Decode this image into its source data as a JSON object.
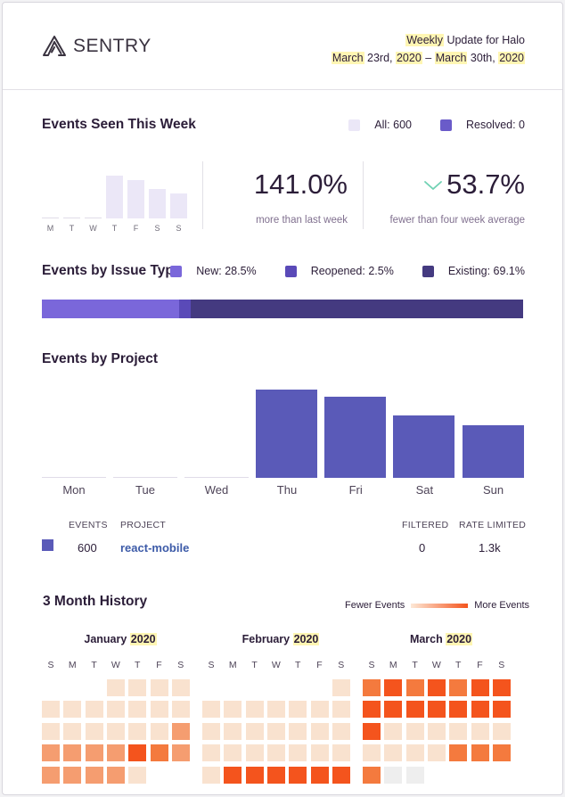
{
  "header": {
    "logo_text": "SENTRY",
    "line1_hl": "Weekly",
    "line1_rest": " Update for Halo",
    "line2": [
      "March",
      " 23rd, ",
      "2020",
      " – ",
      "March",
      " 30th, ",
      "2020"
    ]
  },
  "events_week": {
    "title": "Events Seen This Week",
    "legend_all": "All: 600",
    "legend_resolved": "Resolved: 0",
    "days": [
      "M",
      "T",
      "W",
      "T",
      "F",
      "S",
      "S"
    ],
    "chart_data": {
      "type": "bar",
      "categories": [
        "M",
        "T",
        "W",
        "T",
        "F",
        "S",
        "S"
      ],
      "values": [
        0,
        0,
        0,
        48,
        43,
        33,
        28
      ]
    },
    "stat1_value": "141.0%",
    "stat1_label": "more than last week",
    "stat2_value": "53.7%",
    "stat2_label": "fewer than four week average",
    "colors": {
      "all": "#ebe7f7",
      "resolved": "#6a5bc9",
      "down_arrow": "#6fd1b3"
    }
  },
  "issue_type": {
    "title": "Events by Issue Type",
    "new_label": "New: 28.5%",
    "reopened_label": "Reopened: 2.5%",
    "existing_label": "Existing: 69.1%",
    "chart_data": {
      "type": "bar",
      "categories": [
        "New",
        "Reopened",
        "Existing"
      ],
      "values": [
        28.5,
        2.5,
        69.1
      ]
    },
    "colors": {
      "new": "#7a67da",
      "reopened": "#5a4ab8",
      "existing": "#443a80"
    }
  },
  "project": {
    "title": "Events by Project",
    "days": [
      "Mon",
      "Tue",
      "Wed",
      "Thu",
      "Fri",
      "Sat",
      "Sun"
    ],
    "chart_data": {
      "type": "bar",
      "categories": [
        "Mon",
        "Tue",
        "Wed",
        "Thu",
        "Fri",
        "Sat",
        "Sun"
      ],
      "values": [
        0,
        0,
        0,
        196,
        181,
        139,
        117
      ]
    },
    "table": {
      "headers": {
        "events": "EVENTS",
        "project": "PROJECT",
        "filtered": "FILTERED",
        "rate_limited": "RATE LIMITED"
      },
      "row": {
        "events": "600",
        "project": "react-mobile",
        "filtered": "0",
        "rate_limited": "1.3k"
      }
    },
    "color": "#5a5ab8"
  },
  "history": {
    "title": "3 Month History",
    "fewer": "Fewer Events",
    "more": "More Events",
    "months": [
      {
        "name": "January",
        "year": "2020"
      },
      {
        "name": "February",
        "year": "2020"
      },
      {
        "name": "March",
        "year": "2020"
      }
    ],
    "dow": [
      "S",
      "M",
      "T",
      "W",
      "T",
      "F",
      "S"
    ],
    "levels": [
      [
        [
          null,
          null,
          null,
          1,
          1,
          1,
          1
        ],
        [
          1,
          1,
          1,
          1,
          1,
          1,
          1
        ],
        [
          1,
          1,
          1,
          1,
          1,
          1,
          3
        ],
        [
          3,
          3,
          3,
          3,
          5,
          4,
          3
        ],
        [
          3,
          3,
          3,
          3,
          1,
          null,
          null
        ]
      ],
      [
        [
          null,
          null,
          null,
          null,
          null,
          null,
          1
        ],
        [
          1,
          1,
          1,
          1,
          1,
          1,
          1
        ],
        [
          1,
          1,
          1,
          1,
          1,
          1,
          1
        ],
        [
          1,
          1,
          1,
          1,
          1,
          1,
          1
        ],
        [
          1,
          5,
          5,
          5,
          5,
          5,
          5
        ]
      ],
      [
        [
          4,
          5,
          4,
          5,
          4,
          5,
          5
        ],
        [
          5,
          5,
          5,
          5,
          5,
          5,
          5
        ],
        [
          5,
          1,
          1,
          1,
          1,
          1,
          1
        ],
        [
          1,
          1,
          1,
          1,
          4,
          4,
          4
        ],
        [
          4,
          0,
          0,
          null,
          null,
          null,
          null
        ]
      ]
    ],
    "level_colors": [
      "#eeeeee",
      "#f9e2cf",
      "#fbd2b5",
      "#f59d70",
      "#f47a3e",
      "#f4541d"
    ]
  }
}
